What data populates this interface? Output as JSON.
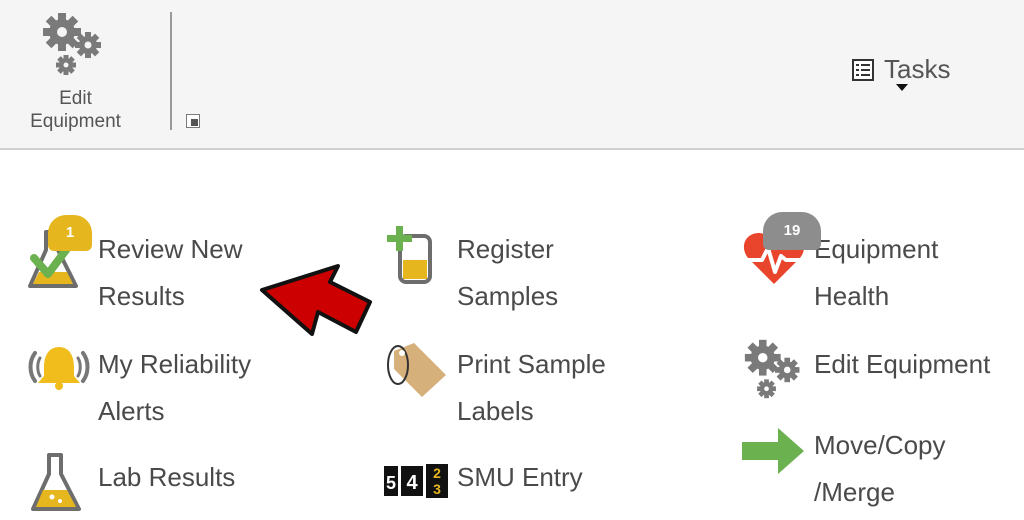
{
  "ribbon": {
    "edit_equipment_line1": "Edit",
    "edit_equipment_line2": "Equipment",
    "tasks_label": "Tasks"
  },
  "tiles": [
    {
      "line1": "Review New",
      "line2": "Results",
      "icon": "flask-check-icon",
      "badge": "1"
    },
    {
      "line1": "My Reliability",
      "line2": "Alerts",
      "icon": "bell-alert-icon"
    },
    {
      "line1": "Lab Results",
      "icon": "flask-icon"
    },
    {
      "line1": "Register",
      "line2": "Samples",
      "icon": "register-sample-icon"
    },
    {
      "line1": "Print Sample",
      "line2": "Labels",
      "icon": "tag-icon"
    },
    {
      "line1": "SMU Entry",
      "icon": "smu-counter-icon",
      "digits": [
        "5",
        "4",
        "2",
        "3"
      ]
    },
    {
      "line1": "Equipment",
      "line2": "Health",
      "icon": "heart-health-icon",
      "badge": "19"
    },
    {
      "line1": "Edit Equipment",
      "icon": "gears-icon"
    },
    {
      "line1": "Move/Copy",
      "line2": "/Merge",
      "icon": "green-arrow-icon"
    }
  ],
  "colors": {
    "badge_yellow": "#e6b61e",
    "badge_gray": "#8d8d8d",
    "arrow_red": "#cc0000",
    "gear_gray": "#7a7a7a",
    "green": "#6cb14f",
    "heart_red": "#e8452c"
  }
}
